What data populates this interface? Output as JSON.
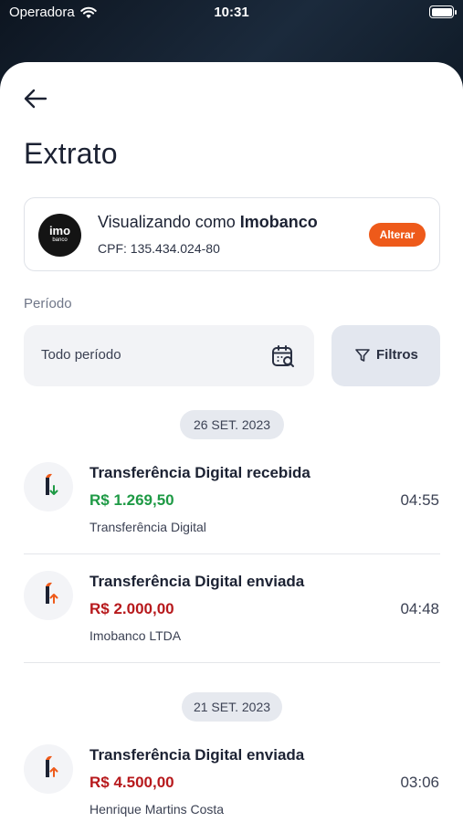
{
  "status_bar": {
    "carrier": "Operadora",
    "time": "10:31"
  },
  "page": {
    "title": "Extrato"
  },
  "account": {
    "logo_main": "imo",
    "logo_sub": "banco",
    "viewing_prefix": "Visualizando como ",
    "name": "Imobanco",
    "cpf": "CPF: 135.434.024-80",
    "change_label": "Alterar"
  },
  "period": {
    "label": "Período",
    "value": "Todo período",
    "filters_label": "Filtros"
  },
  "colors": {
    "accent": "#ee5a1a",
    "credit": "#1e9a45",
    "debit": "#b7191c"
  },
  "groups": [
    {
      "date": "26 SET. 2023",
      "transactions": [
        {
          "title": "Transferência Digital recebida",
          "amount": "R$ 1.269,50",
          "type": "credit",
          "description": "Transferência Digital",
          "time": "04:55",
          "icon": "transfer-received-icon"
        },
        {
          "title": "Transferência Digital enviada",
          "amount": "R$ 2.000,00",
          "type": "debit",
          "description": "Imobanco LTDA",
          "time": "04:48",
          "icon": "transfer-sent-icon"
        }
      ]
    },
    {
      "date": "21 SET. 2023",
      "transactions": [
        {
          "title": "Transferência Digital enviada",
          "amount": "R$ 4.500,00",
          "type": "debit",
          "description": "Henrique Martins Costa",
          "time": "03:06",
          "icon": "transfer-sent-icon"
        }
      ]
    }
  ]
}
